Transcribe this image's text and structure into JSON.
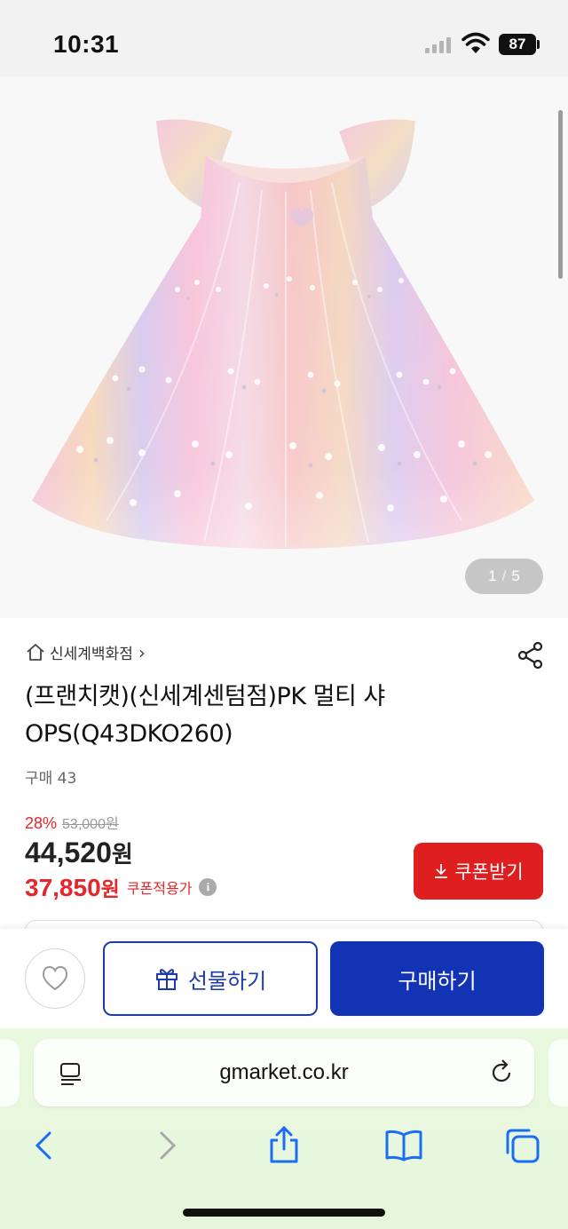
{
  "status_bar": {
    "time": "10:31",
    "battery": "87"
  },
  "gallery": {
    "current": "1",
    "separator": "/",
    "total": "5"
  },
  "product": {
    "seller": "신세계백화점",
    "seller_chevron": "›",
    "title": "(프랜치캣)(신세계센텀점)PK 멀티 샤 OPS(Q43DKO260)",
    "purchase_count": "구매 43",
    "discount_rate": "28%",
    "original_price": "53,000원",
    "sale_price_number": "44,520",
    "sale_price_unit": "원",
    "coupon_price_number": "37,850",
    "coupon_price_unit": "원",
    "coupon_note": "쿠폰적용가",
    "info_icon": "i",
    "coupon_button": "쿠폰받기"
  },
  "actions": {
    "gift": "선물하기",
    "buy": "구매하기"
  },
  "browser": {
    "url": "gmarket.co.kr"
  },
  "colors": {
    "accent_red": "#df1f1f",
    "brand_blue": "#1133b4",
    "safari_green": "#e9f8de"
  },
  "icons": [
    "wifi-icon",
    "battery-icon",
    "home-icon",
    "share-icon",
    "download-icon",
    "heart-icon",
    "gift-icon",
    "reader-icon",
    "reload-icon",
    "back-icon",
    "forward-icon",
    "share-sheet-icon",
    "bookmarks-icon",
    "tabs-icon"
  ]
}
